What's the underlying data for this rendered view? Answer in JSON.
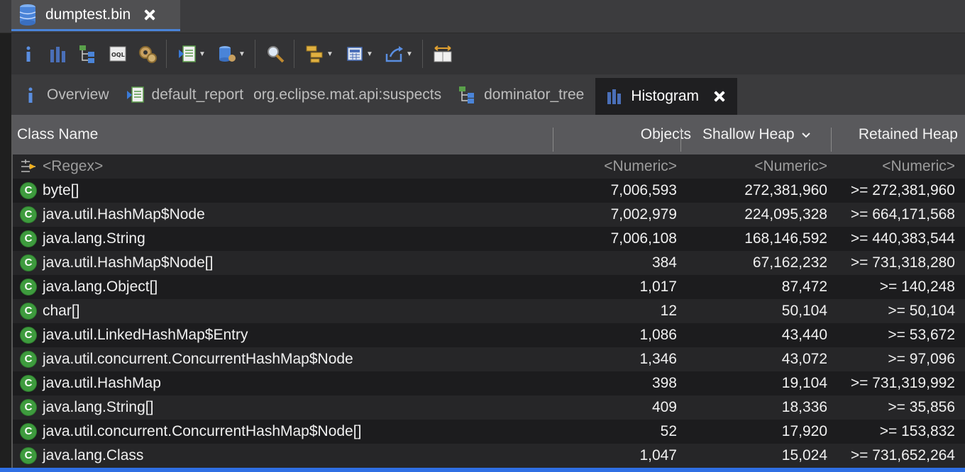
{
  "editor": {
    "tab_title": "dumptest.bin",
    "icon": "database-icon"
  },
  "toolbar": {
    "buttons": [
      {
        "name": "info-icon"
      },
      {
        "name": "histogram-icon"
      },
      {
        "name": "dominator-tree-icon"
      },
      {
        "name": "oql-icon"
      },
      {
        "name": "heap-dump-overview-icon"
      },
      {
        "name": "run-report-icon",
        "dropdown": true
      },
      {
        "name": "query-browser-icon",
        "dropdown": true
      },
      {
        "name": "find-object-icon"
      },
      {
        "name": "group-by-icon",
        "dropdown": true
      },
      {
        "name": "calculator-icon",
        "dropdown": true
      },
      {
        "name": "export-icon",
        "dropdown": true
      },
      {
        "name": "columns-icon"
      }
    ]
  },
  "view_tabs": [
    {
      "label": "Overview",
      "icon": "info-icon"
    },
    {
      "label": "default_report",
      "icon": "report-icon"
    },
    {
      "label": "org.eclipse.mat.api:suspects",
      "icon": ""
    },
    {
      "label": "dominator_tree",
      "icon": "dominator-tree-icon"
    },
    {
      "label": "Histogram",
      "icon": "histogram-icon",
      "active": true
    }
  ],
  "table": {
    "columns": {
      "class_name": "Class Name",
      "objects": "Objects",
      "shallow_heap": "Shallow Heap",
      "retained_heap": "Retained Heap"
    },
    "sort_indicator": "chevron-down-icon",
    "filter_row": {
      "class_name": "<Regex>",
      "objects": "<Numeric>",
      "shallow_heap": "<Numeric>",
      "retained_heap": "<Numeric>"
    },
    "rows": [
      {
        "class_name": "byte[]",
        "objects": "7,006,593",
        "shallow_heap": "272,381,960",
        "retained_heap": ">= 272,381,960"
      },
      {
        "class_name": "java.util.HashMap$Node",
        "objects": "7,002,979",
        "shallow_heap": "224,095,328",
        "retained_heap": ">= 664,171,568"
      },
      {
        "class_name": "java.lang.String",
        "objects": "7,006,108",
        "shallow_heap": "168,146,592",
        "retained_heap": ">= 440,383,544"
      },
      {
        "class_name": "java.util.HashMap$Node[]",
        "objects": "384",
        "shallow_heap": "67,162,232",
        "retained_heap": ">= 731,318,280"
      },
      {
        "class_name": "java.lang.Object[]",
        "objects": "1,017",
        "shallow_heap": "87,472",
        "retained_heap": ">= 140,248"
      },
      {
        "class_name": "char[]",
        "objects": "12",
        "shallow_heap": "50,104",
        "retained_heap": ">= 50,104"
      },
      {
        "class_name": "java.util.LinkedHashMap$Entry",
        "objects": "1,086",
        "shallow_heap": "43,440",
        "retained_heap": ">= 53,672"
      },
      {
        "class_name": "java.util.concurrent.ConcurrentHashMap$Node",
        "objects": "1,346",
        "shallow_heap": "43,072",
        "retained_heap": ">= 97,096"
      },
      {
        "class_name": "java.util.HashMap",
        "objects": "398",
        "shallow_heap": "19,104",
        "retained_heap": ">= 731,319,992"
      },
      {
        "class_name": "java.lang.String[]",
        "objects": "409",
        "shallow_heap": "18,336",
        "retained_heap": ">= 35,856"
      },
      {
        "class_name": "java.util.concurrent.ConcurrentHashMap$Node[]",
        "objects": "52",
        "shallow_heap": "17,920",
        "retained_heap": ">= 153,832"
      },
      {
        "class_name": "java.lang.Class",
        "objects": "1,047",
        "shallow_heap": "15,024",
        "retained_heap": ">= 731,652,264"
      }
    ],
    "class_icon_letter": "C"
  },
  "colors": {
    "accent": "#4a84d8",
    "class_icon": "#3e9b3e",
    "selection": "#2f6fe4"
  }
}
